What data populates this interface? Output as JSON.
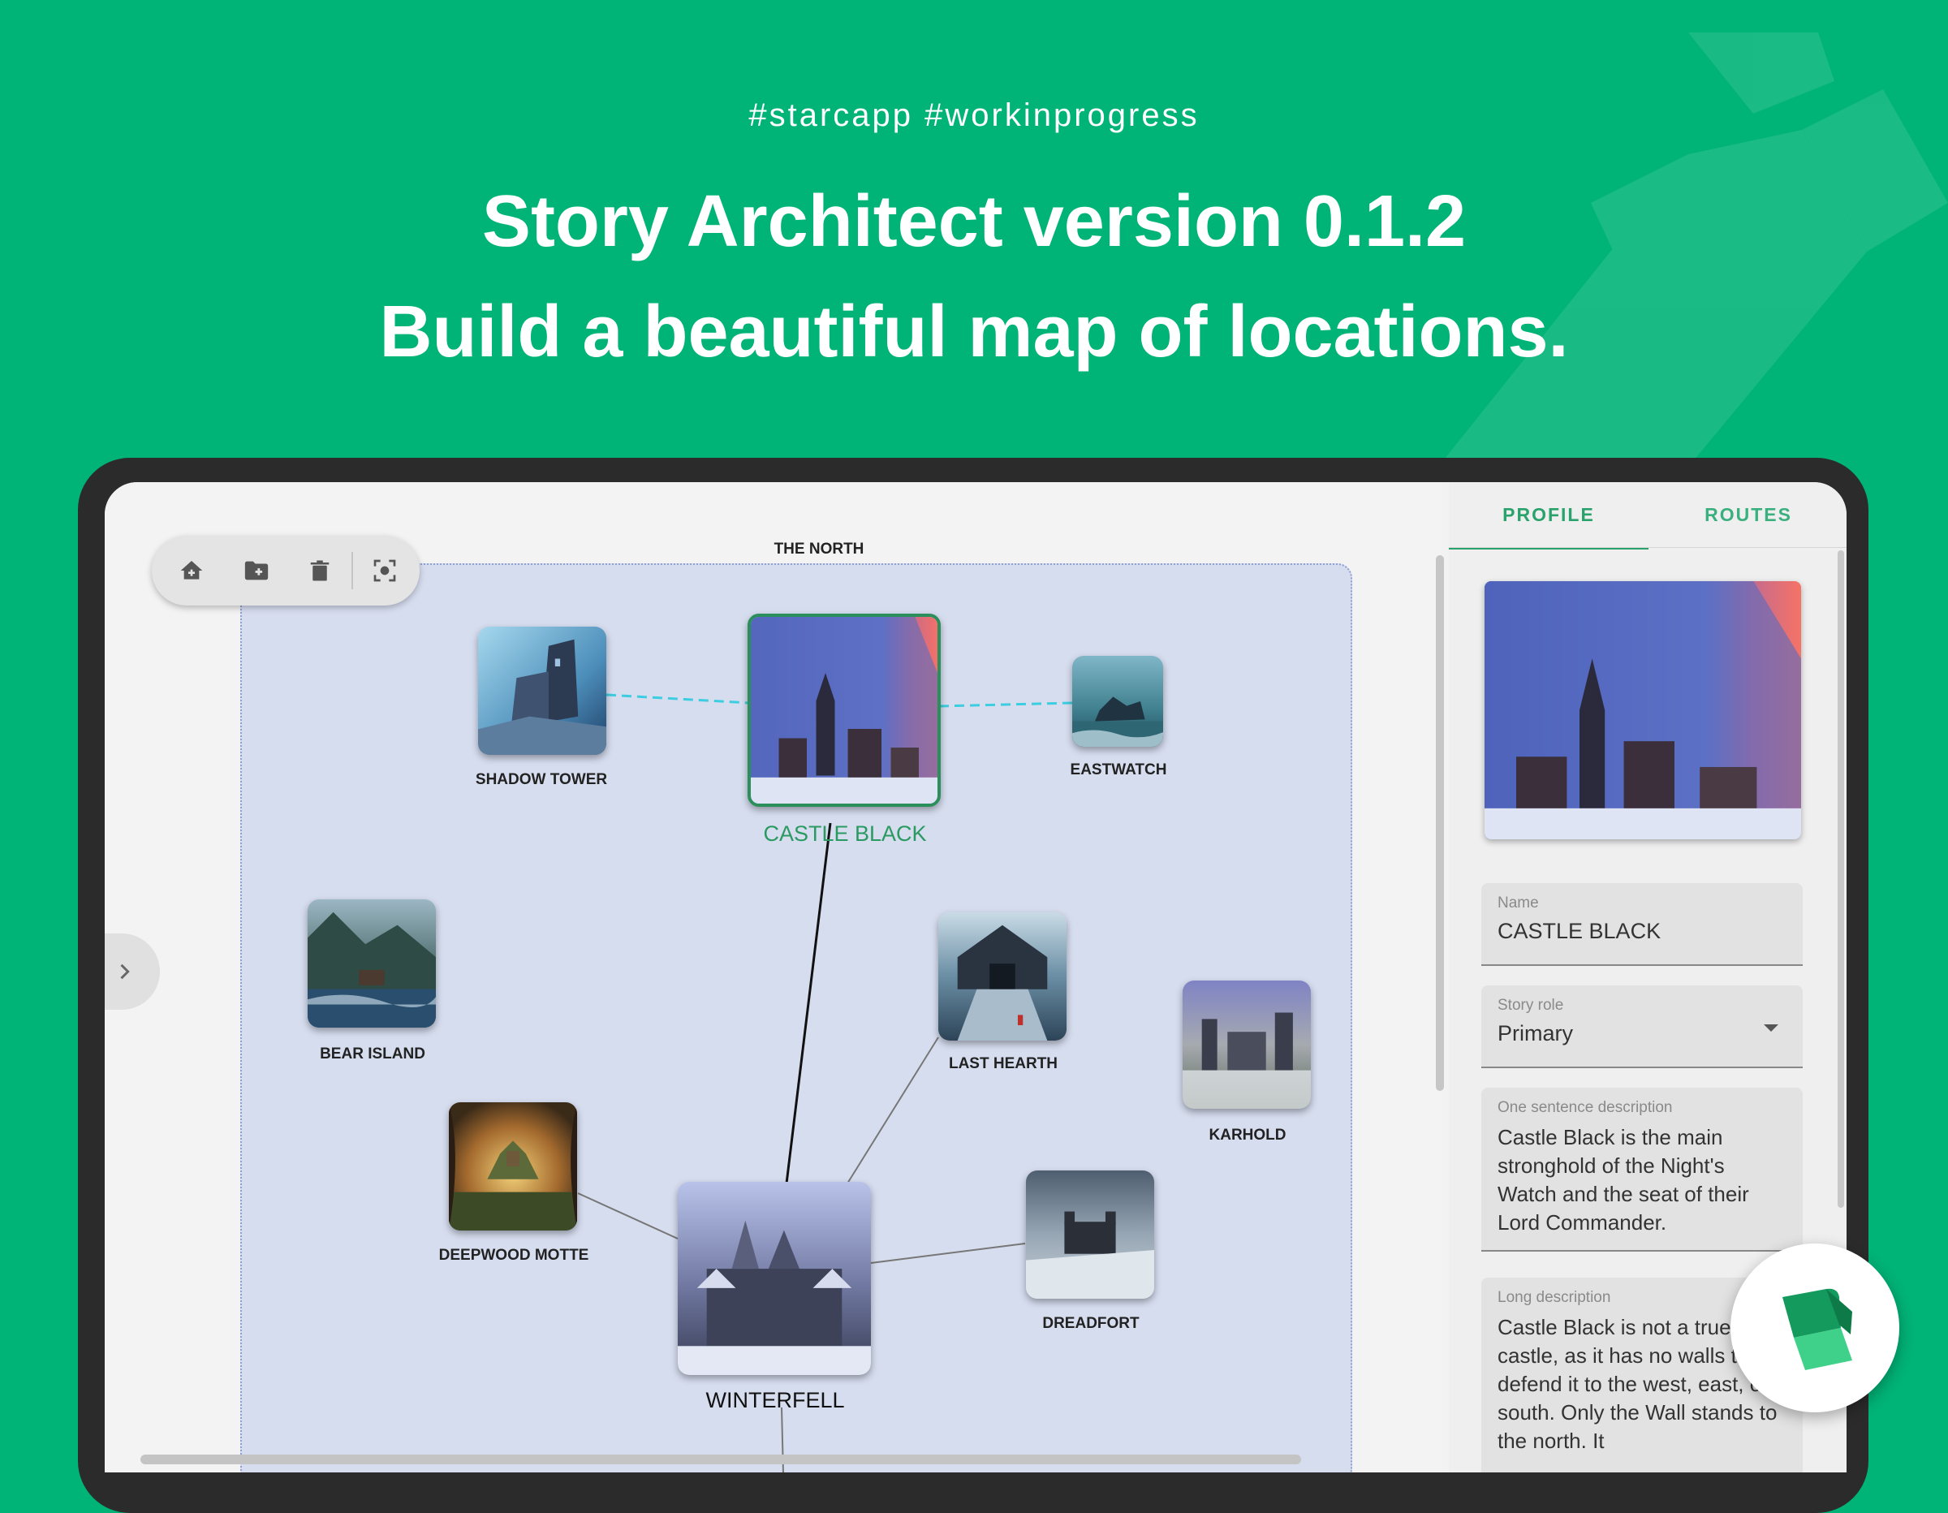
{
  "header": {
    "hashtags": "#starcapp  #workinprogress",
    "title_line1": "Story Architect version 0.1.2",
    "title_line2": "Build a beautiful map of locations."
  },
  "colors": {
    "background": "#00b377",
    "accent": "#2aa26c",
    "region_fill": "#d6ddef",
    "route_dashed": "#3ccde0"
  },
  "toolbar": {
    "icons": [
      "home-plus-icon",
      "folder-plus-icon",
      "trash-icon",
      "fit-screen-icon"
    ]
  },
  "map": {
    "region_title": "THE NORTH",
    "locations": {
      "shadow_tower": "SHADOW TOWER",
      "castle_black": "CASTLE BLACK",
      "eastwatch": "EASTWATCH",
      "bear_island": "BEAR ISLAND",
      "last_hearth": "LAST HEARTH",
      "karhold": "KARHOLD",
      "deepwood_motte": "DEEPWOOD MOTTE",
      "winterfell": "WINTERFELL",
      "dreadfort": "DREADFORT"
    },
    "selected": "CASTLE BLACK"
  },
  "panel": {
    "tabs": [
      "PROFILE",
      "ROUTES"
    ],
    "active_tab": "PROFILE",
    "name": {
      "label": "Name",
      "value": "CASTLE BLACK"
    },
    "story_role": {
      "label": "Story role",
      "value": "Primary"
    },
    "short_description": {
      "label": "One sentence description",
      "value": "Castle Black is the main stronghold of the Night's Watch and the seat of their Lord Commander."
    },
    "long_description": {
      "label": "Long description",
      "value": "Castle Black is not a true castle, as it has no walls to defend it to the west, east, or south. Only the Wall stands to the north. It"
    }
  }
}
